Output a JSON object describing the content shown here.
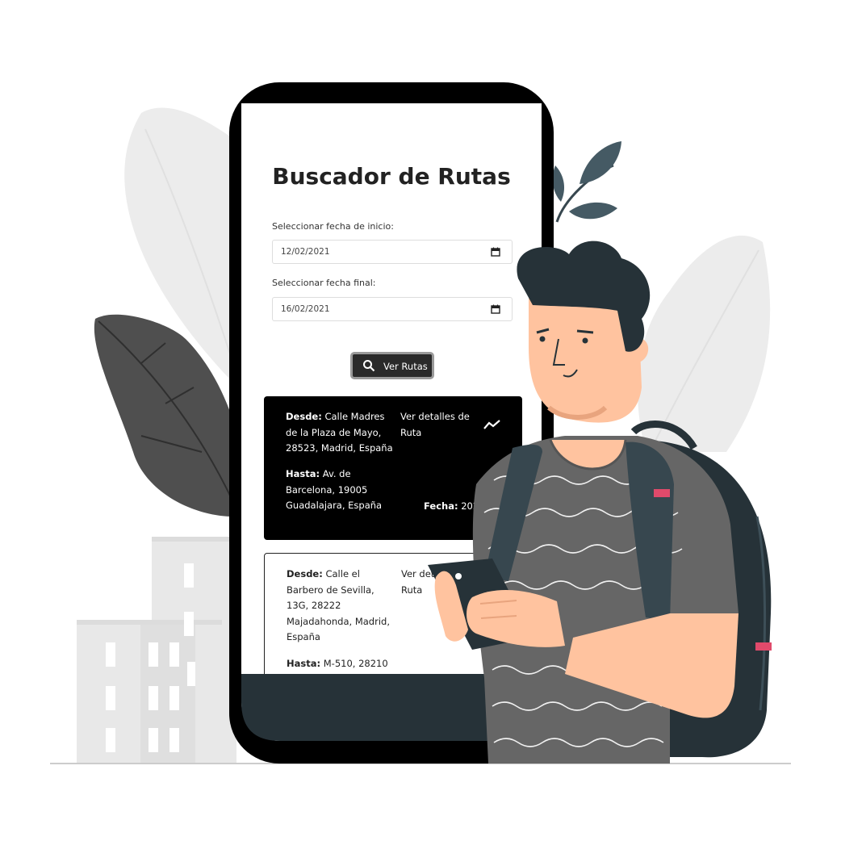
{
  "app": {
    "title": "Buscador de Rutas",
    "start_label": "Seleccionar fecha de inicio:",
    "start_value": "12/02/2021",
    "end_label": "Seleccionar fecha final:",
    "end_value": "16/02/2021",
    "search_button": "Ver Rutas"
  },
  "routes": [
    {
      "desde_label": "Desde:",
      "desde_1": "Calle Madres",
      "desde_2": "de la Plaza de Mayo,",
      "desde_3": "28523, Madrid, España",
      "hasta_label": "Hasta:",
      "hasta_1": "Av. de",
      "hasta_2": "Barcelona, 19005",
      "hasta_3": "Guadalajara, España",
      "details_1": "Ver detalles de",
      "details_2": "Ruta",
      "fecha_label": "Fecha:",
      "fecha_value": "2021-"
    },
    {
      "desde_label": "Desde:",
      "desde_1": "Calle el",
      "desde_2": "Barbero de Sevilla,",
      "desde_3": "13G, 28222",
      "desde_4": "Majadahonda, Madrid,",
      "desde_5": "España",
      "hasta_label": "Hasta:",
      "hasta_1": "M-510, 28210",
      "details_1": "Ver deta",
      "details_2": "Ruta"
    }
  ],
  "colors": {
    "phone": "#000000",
    "card_dark": "#000000",
    "button": "#2a2a2a",
    "accent_pink": "#e04a6b",
    "skin": "#ffc39f",
    "hair": "#263238",
    "shirt": "#666666",
    "backpack": "#263238"
  },
  "icons": {
    "search": "search-icon",
    "calendar": "calendar-icon",
    "trend": "trend-icon"
  }
}
